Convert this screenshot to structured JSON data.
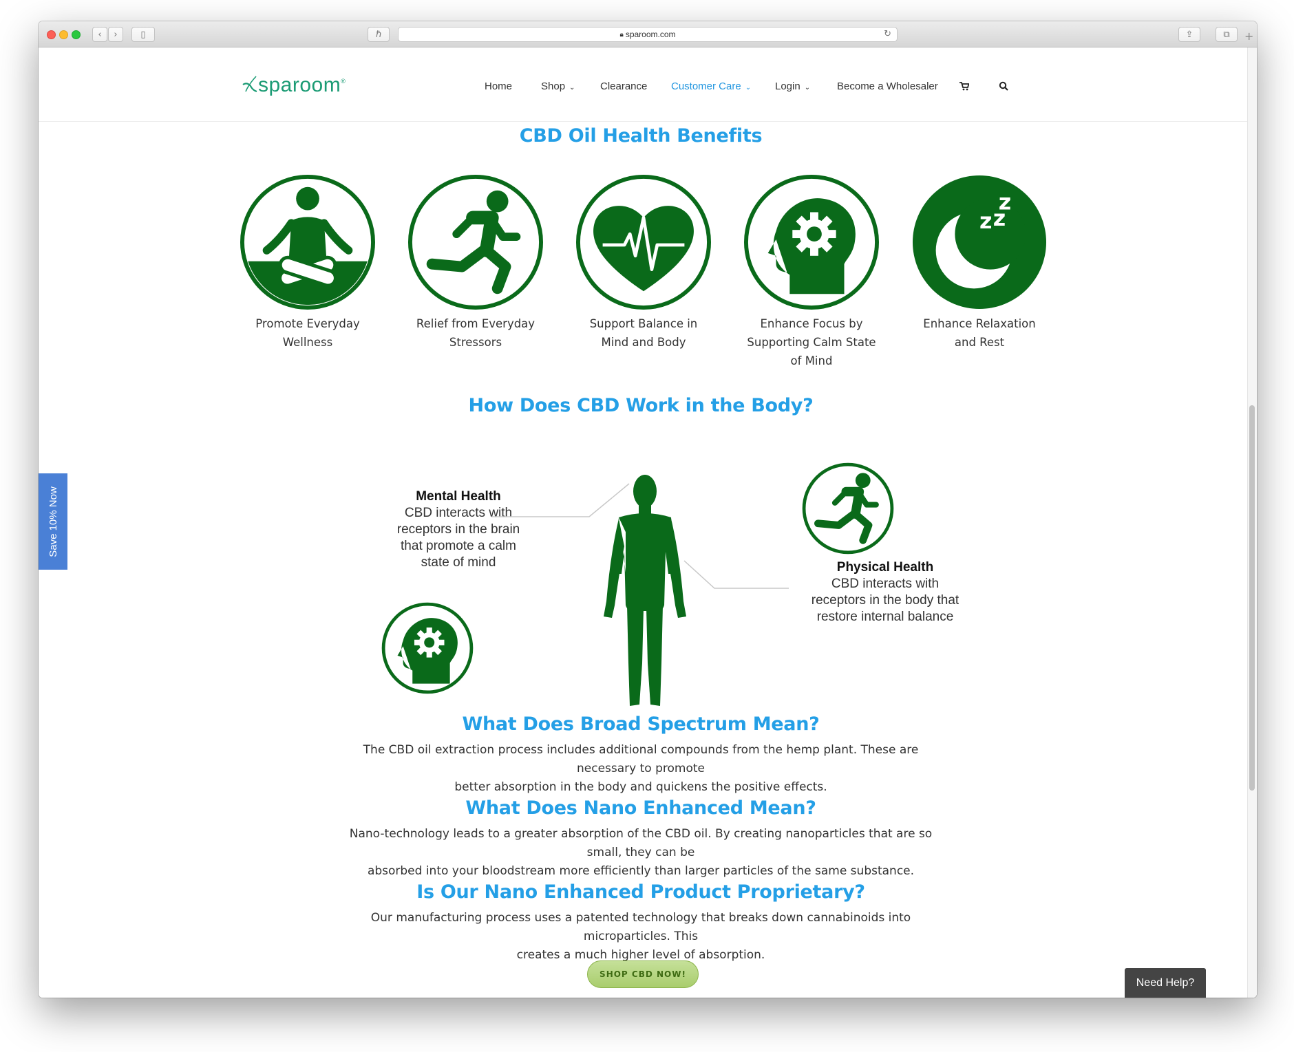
{
  "browser": {
    "url": "sparoom.com"
  },
  "colors": {
    "brand_green": "#0a6a1a",
    "heading_blue": "#249fe6",
    "button_green": "#a9cd6d",
    "save_tab_blue": "#4a80d6"
  },
  "header": {
    "logo": "sparoom",
    "nav": [
      {
        "label": "Home"
      },
      {
        "label": "Shop"
      },
      {
        "label": "Clearance"
      },
      {
        "label": "Customer Care"
      },
      {
        "label": "Login"
      },
      {
        "label": "Become a Wholesaler"
      }
    ],
    "cart_icon": "cart-icon",
    "search_icon": "search-icon"
  },
  "benefits": {
    "heading": "CBD Oil Health Benefits",
    "items": [
      {
        "icon": "meditation-icon",
        "line1": "Promote Everyday",
        "line2": "Wellness",
        "line3": ""
      },
      {
        "icon": "running-icon",
        "line1": "Relief from Everyday",
        "line2": "Stressors",
        "line3": ""
      },
      {
        "icon": "heartbeat-icon",
        "line1": "Support Balance in",
        "line2": "Mind and Body",
        "line3": ""
      },
      {
        "icon": "brain-gear-icon",
        "line1": "Enhance Focus by",
        "line2": "Supporting Calm State",
        "line3": "of Mind"
      },
      {
        "icon": "moon-sleep-icon",
        "line1": "Enhance Relaxation",
        "line2": "and Rest",
        "line3": ""
      }
    ]
  },
  "how_it_works": {
    "heading": "How Does CBD Work in the Body?",
    "mental": {
      "title": "Mental Health",
      "line1": "CBD interacts with",
      "line2": "receptors in the brain",
      "line3": "that promote a calm",
      "line4": "state of mind"
    },
    "physical": {
      "title": "Physical Health",
      "line1": "CBD interacts with",
      "line2": "receptors in the body that",
      "line3": "restore internal balance"
    }
  },
  "sections": [
    {
      "heading": "What Does Broad Spectrum Mean?",
      "line1": "The CBD oil extraction process includes additional compounds from the hemp plant. These are necessary to promote",
      "line2": "better absorption in the body and quickens the positive effects."
    },
    {
      "heading": "What Does Nano Enhanced Mean?",
      "line1": "Nano-technology leads to a greater absorption of the CBD oil. By creating nanoparticles that are so small, they can be",
      "line2": "absorbed into your bloodstream more efficiently than larger particles of the same substance."
    },
    {
      "heading": "Is Our Nano Enhanced Product Proprietary?",
      "line1": "Our manufacturing process uses a patented technology that breaks down cannabinoids into microparticles. This",
      "line2": "creates a much higher level of absorption."
    }
  ],
  "cta": {
    "label": "SHOP CBD NOW!"
  },
  "save_tab": {
    "label": "Save 10% Now"
  },
  "help": {
    "label": "Need Help?"
  }
}
